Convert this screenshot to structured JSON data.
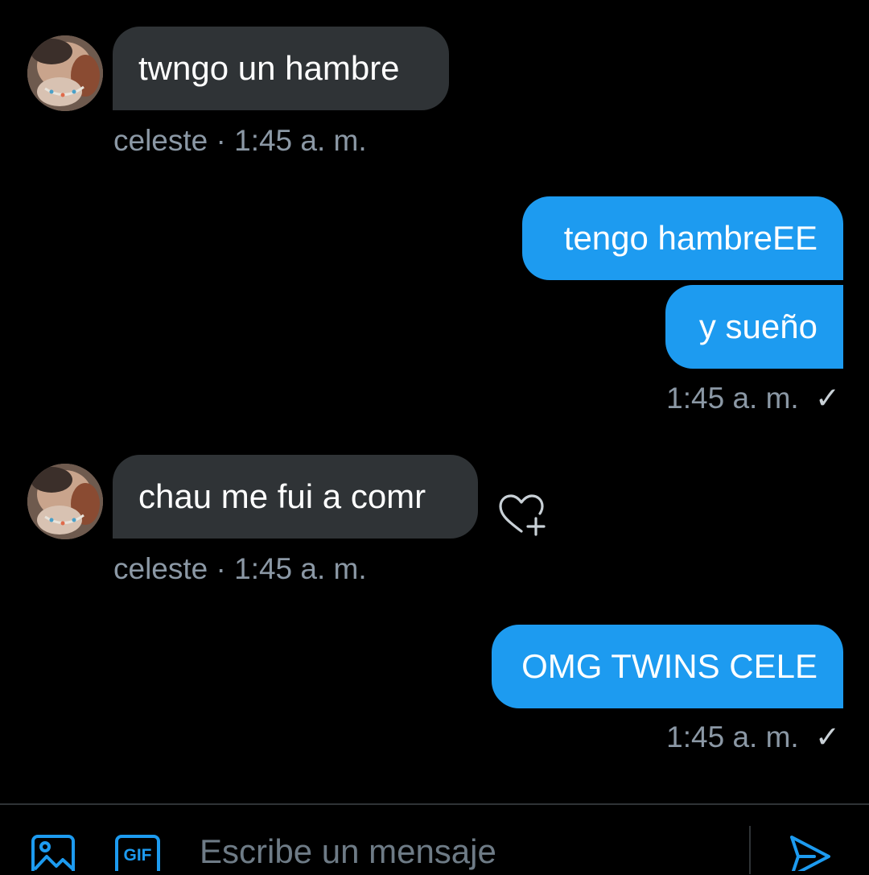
{
  "messages": [
    {
      "direction": "incoming",
      "text": "twngo un hambre",
      "sender": "celeste",
      "separator": "·",
      "time": "1:45 a. m."
    },
    {
      "direction": "outgoing",
      "text": "tengo hambreEE"
    },
    {
      "direction": "outgoing",
      "text": "y sueño",
      "time": "1:45 a. m.",
      "status": "sent",
      "status_glyph": "✓"
    },
    {
      "direction": "incoming",
      "text": "chau me fui a comr",
      "sender": "celeste",
      "separator": "·",
      "time": "1:45 a. m."
    },
    {
      "direction": "outgoing",
      "text": "OMG TWINS CELE",
      "time": "1:45 a. m.",
      "status": "sent",
      "status_glyph": "✓"
    }
  ],
  "composer": {
    "placeholder": "Escribe un mensaje",
    "image_icon": "image-icon",
    "gif_icon": "gif-icon",
    "gif_label": "GIF",
    "send_icon": "send-icon"
  },
  "react_icon": "heart-plus-icon",
  "colors": {
    "background": "#000000",
    "incoming_bubble": "#2f3336",
    "outgoing_bubble": "#1d9bf0",
    "accent": "#1d9bf0",
    "meta_text": "#8b98a5"
  }
}
